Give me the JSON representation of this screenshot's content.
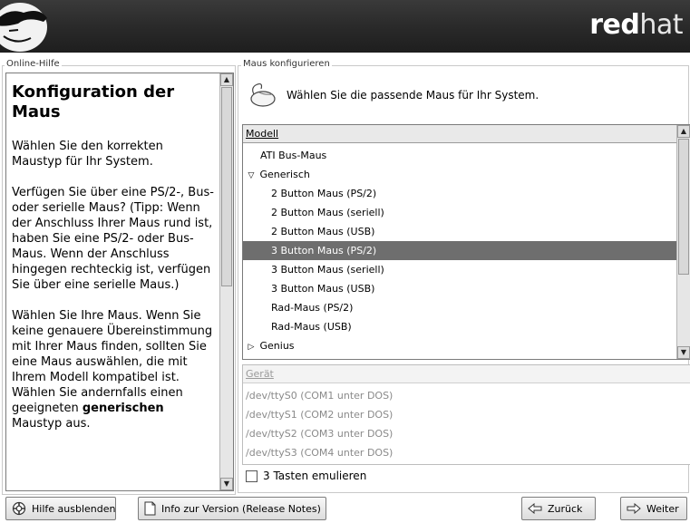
{
  "banner": {
    "brand_bold": "red",
    "brand_light": "hat"
  },
  "help": {
    "legend": "Online-Hilfe",
    "title": "Konfiguration der Maus",
    "p1": "Wählen Sie den korrekten Maustyp für Ihr System.",
    "p2": "Verfügen Sie über eine PS/2-, Bus- oder serielle Maus? (Tipp: Wenn der Anschluss Ihrer Maus rund ist, haben Sie eine PS/2- oder Bus-Maus. Wenn der Anschluss hingegen rechteckig ist, verfügen Sie über eine serielle Maus.)",
    "p3_start": "Wählen Sie Ihre Maus. Wenn Sie keine genauere Übereinstimmung mit Ihrer Maus finden, sollten Sie eine Maus auswählen, die mit Ihrem Modell kompatibel ist. Wählen Sie andernfalls einen geeigneten ",
    "p3_bold": "generischen",
    "p3_end": " Maustyp aus."
  },
  "config": {
    "legend": "Maus konfigurieren",
    "prompt": "Wählen Sie die passende Maus für Ihr System.",
    "model_header": "Modell",
    "models": [
      {
        "label": "ATI Bus-Maus"
      },
      {
        "label": "Generisch",
        "expander": "▽"
      },
      {
        "label": "2 Button Maus (PS/2)"
      },
      {
        "label": "2 Button Maus (seriell)"
      },
      {
        "label": "2 Button Maus (USB)"
      },
      {
        "label": "3 Button Maus (PS/2)",
        "selected": true
      },
      {
        "label": "3 Button Maus (seriell)"
      },
      {
        "label": "3 Button Maus (USB)"
      },
      {
        "label": "Rad-Maus (PS/2)"
      },
      {
        "label": "Rad-Maus (USB)"
      },
      {
        "label": "Genius",
        "expander": "▷"
      }
    ],
    "device_header": "Gerät",
    "devices": [
      "/dev/ttyS0 (COM1 unter DOS)",
      "/dev/ttyS1 (COM2 unter DOS)",
      "/dev/ttyS2 (COM3 unter DOS)",
      "/dev/ttyS3 (COM4 unter DOS)"
    ],
    "emulate_label": "3 Tasten emulieren",
    "emulate_checked": false
  },
  "footer": {
    "hide_help": "Hilfe ausblenden",
    "release_notes": "Info zur Version (Release Notes)",
    "back": "Zurück",
    "next": "Weiter"
  }
}
